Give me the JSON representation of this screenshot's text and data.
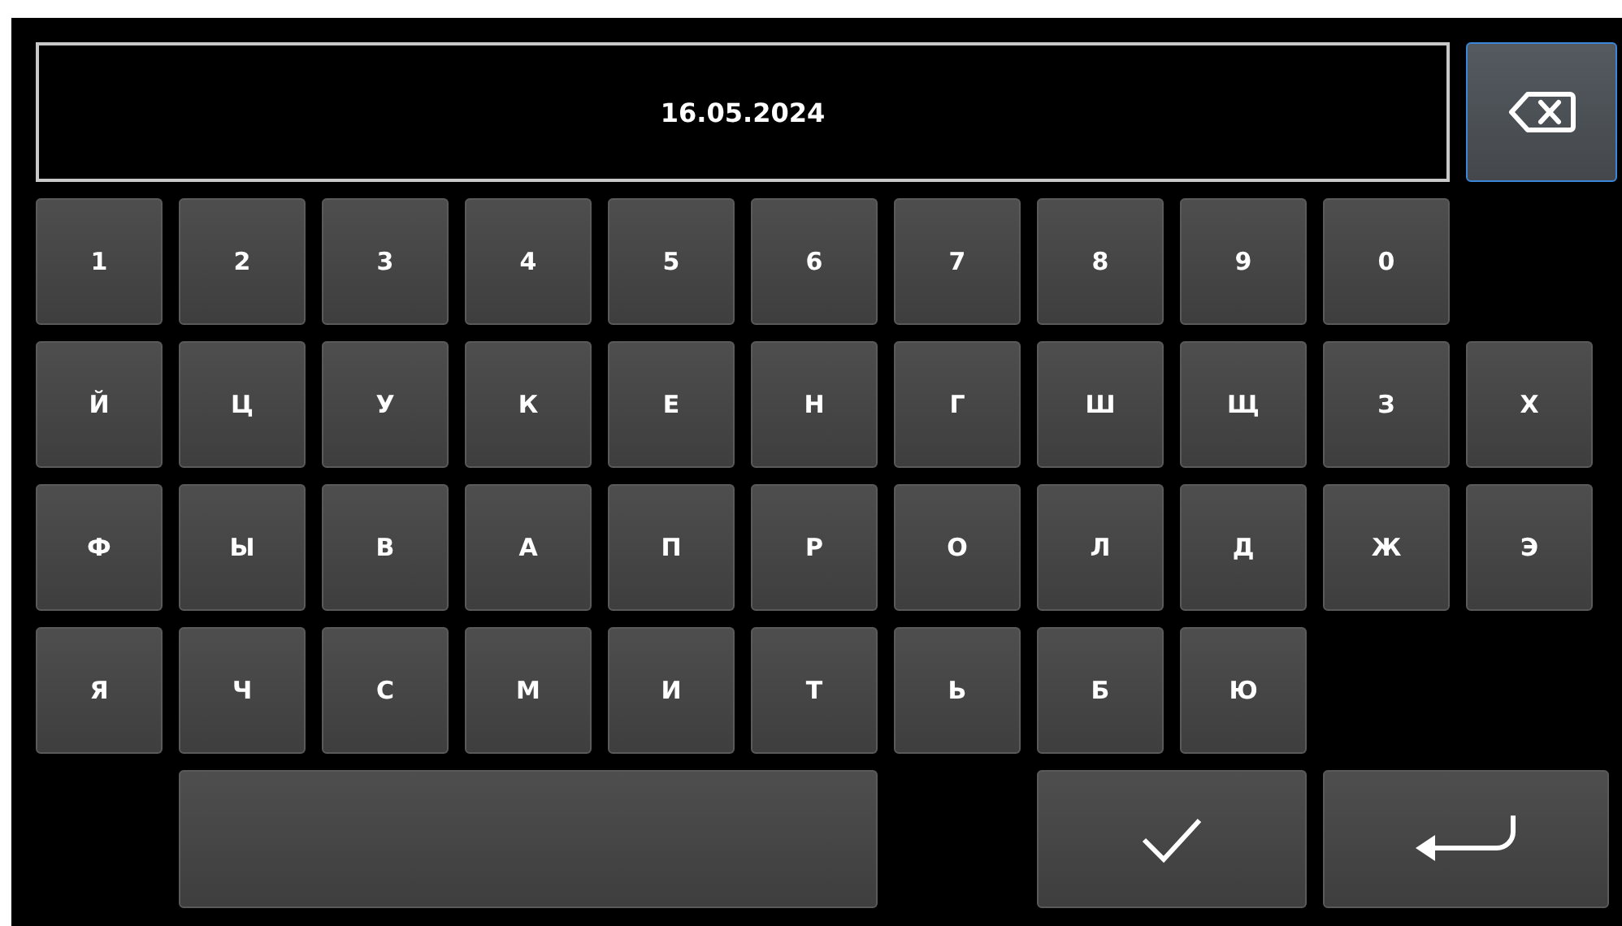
{
  "display": {
    "value": "16.05.2024"
  },
  "backspace": {
    "focused": true
  },
  "rows": [
    [
      "1",
      "2",
      "3",
      "4",
      "5",
      "6",
      "7",
      "8",
      "9",
      "0"
    ],
    [
      "Й",
      "Ц",
      "У",
      "К",
      "Е",
      "Н",
      "Г",
      "Ш",
      "Щ",
      "З",
      "Х"
    ],
    [
      "Ф",
      "Ы",
      "В",
      "А",
      "П",
      "Р",
      "О",
      "Л",
      "Д",
      "Ж",
      "Э"
    ],
    [
      "Я",
      "Ч",
      "С",
      "М",
      "И",
      "Т",
      "Ь",
      "Б",
      "Ю"
    ]
  ],
  "bottom": [
    {
      "kind": "space"
    },
    {
      "kind": "confirm"
    },
    {
      "kind": "enter"
    }
  ]
}
